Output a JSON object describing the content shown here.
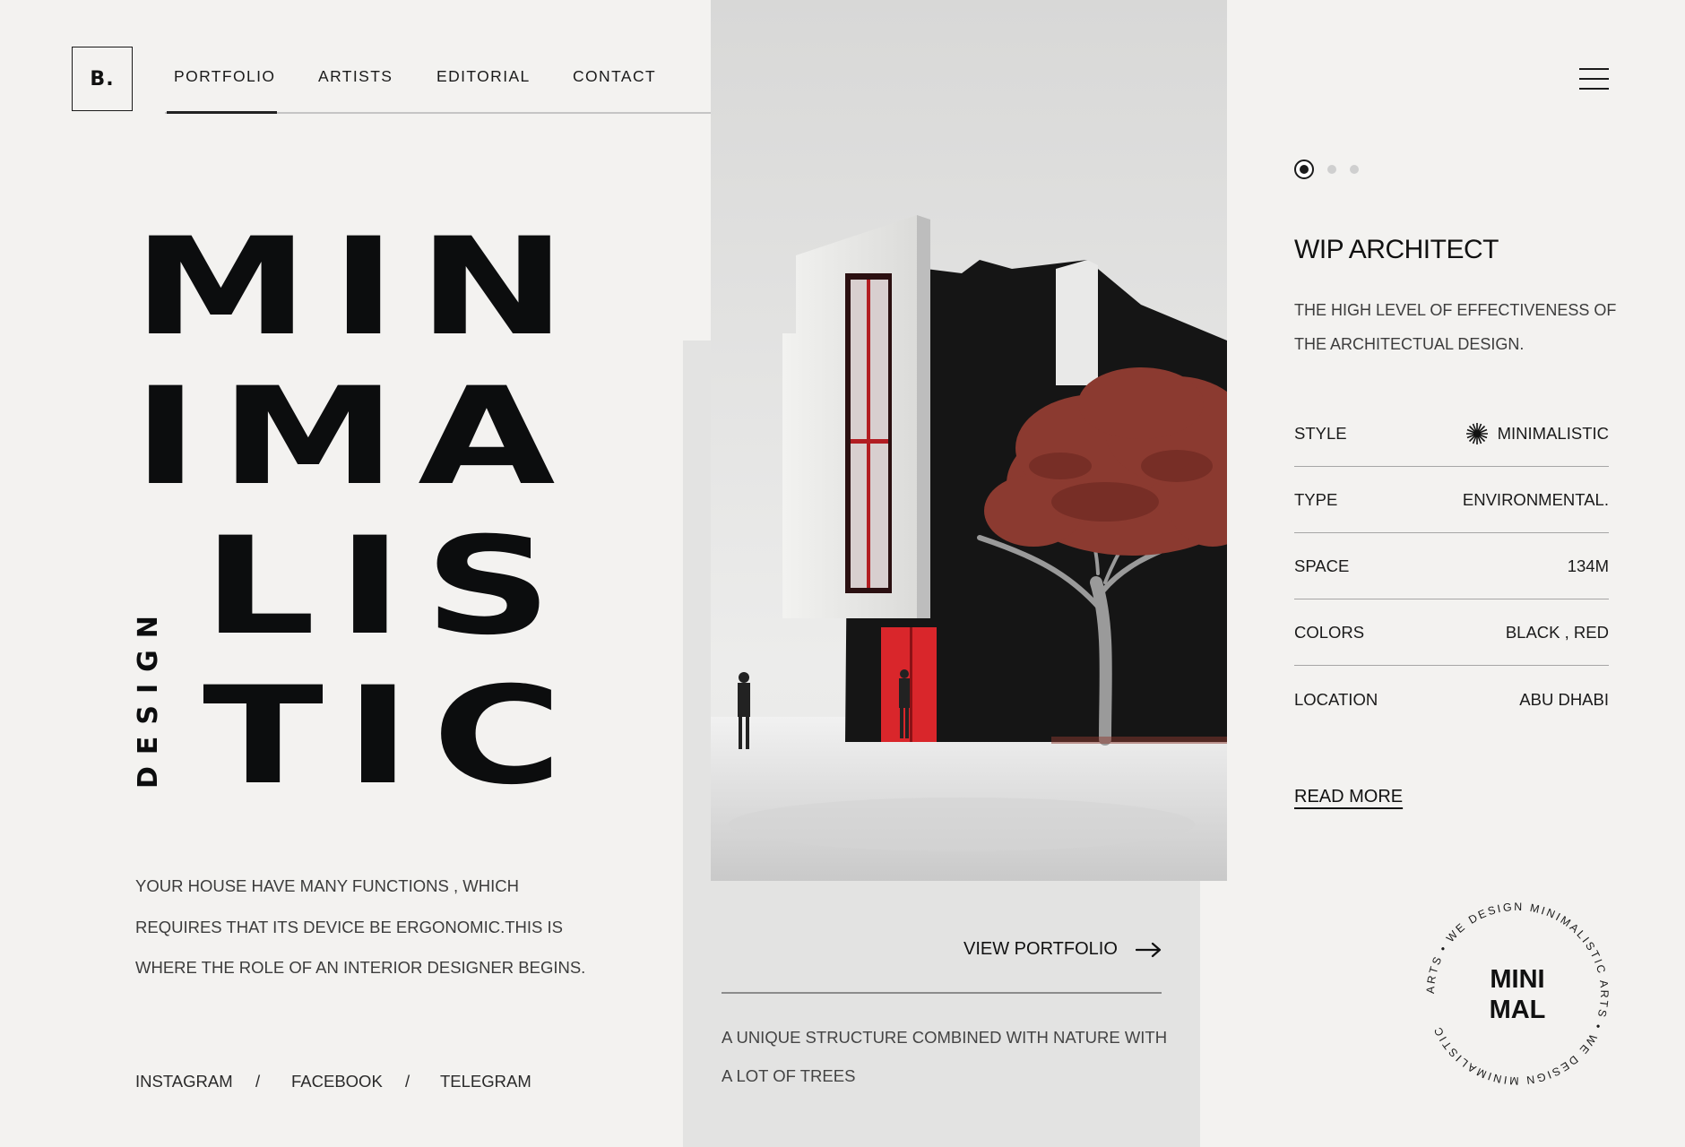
{
  "header": {
    "logo": "B.",
    "nav": [
      "PORTFOLIO",
      "ARTISTS",
      "EDITORIAL",
      "CONTACT"
    ],
    "active_nav": "PORTFOLIO"
  },
  "hero": {
    "title_lines": [
      "MIN",
      "IMA",
      "LIS",
      "TIC"
    ],
    "vertical_label": "DESIGN",
    "description_lines": [
      "YOUR HOUSE HAVE MANY FUNCTIONS , WHICH",
      "REQUIRES THAT ITS DEVICE BE ERGONOMIC.THIS IS",
      "WHERE THE ROLE OF AN INTERIOR DESIGNER BEGINS."
    ]
  },
  "social": {
    "links": [
      "INSTAGRAM",
      "FACEBOOK",
      "TELEGRAM"
    ],
    "separator": "/"
  },
  "middle": {
    "view_portfolio": "VIEW PORTFOLIO",
    "description_lines": [
      "A UNIQUE STRUCTURE COMBINED WITH NATURE WITH",
      "A LOT OF TREES"
    ]
  },
  "right": {
    "slider_count": 3,
    "active_slide": 1,
    "title": "WIP ARCHITECT",
    "description_lines": [
      "THE HIGH LEVEL OF EFFECTIVENESS OF",
      "THE ARCHITECTUAL DESIGN."
    ],
    "specs": [
      {
        "label": "STYLE",
        "value": "MINIMALISTIC",
        "icon": "starburst-icon"
      },
      {
        "label": "TYPE",
        "value": "ENVIRONMENTAL."
      },
      {
        "label": "SPACE",
        "value": "134M"
      },
      {
        "label": "COLORS",
        "value": "BLACK , RED"
      },
      {
        "label": "LOCATION",
        "value": "ABU DHABI"
      }
    ],
    "read_more": "READ MORE"
  },
  "badge": {
    "center_lines": [
      "MINI",
      "MAL"
    ],
    "ring_text": "ARTS • WE DESIGN MINIMALISTIC ARTS • WE DESIGN MINIMALISTIC"
  },
  "colors": {
    "background": "#f3f2f0",
    "panel": "#e3e3e2",
    "text": "#111111",
    "accent_red": "#d9262b",
    "tree": "#8b3a30"
  },
  "icons": {
    "menu": "hamburger-menu-icon",
    "arrow": "arrow-right-icon",
    "style": "starburst-icon"
  }
}
